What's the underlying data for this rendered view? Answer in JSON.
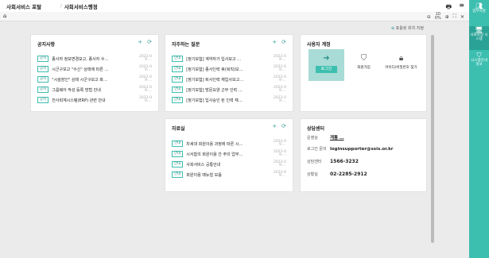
{
  "header": {
    "brand": "사회서비스 포탈",
    "sep": "/",
    "breadcrumb": "사회서비스행정"
  },
  "toolbar": {
    "home_icon": "⌂",
    "zoom": "10",
    "zoom_unit": "0%"
  },
  "hint": {
    "icon": "⊕",
    "text": "포틀릿 위치 지정"
  },
  "rail": [
    {
      "icon": "person-card-icon",
      "glyph": "⌂",
      "label": "업무지원"
    },
    {
      "icon": "monitor-icon",
      "glyph": "▤",
      "label": "사회보장 시스템"
    },
    {
      "icon": "shield-icon",
      "glyph": "◈",
      "label": "시스템안내 정보"
    }
  ],
  "notices": {
    "title": "공지사항",
    "rows": [
      {
        "badge": "공지",
        "text": "종사자 정보변경보고, 종사자 수…",
        "date": "2022-09-…"
      },
      {
        "badge": "공지",
        "text": "시군구보고 \"수신\" 상태에 따른 …",
        "date": "2022-09-…"
      },
      {
        "badge": "공지",
        "text": "\"시설장인\" 상태 시군구보고 화…",
        "date": "2022-09-…"
      },
      {
        "badge": "공지",
        "text": "그룹웨어 작성 등록 방법 안내",
        "date": "2022-09-…"
      },
      {
        "badge": "공지",
        "text": "전사회계시스템(ERP) 관련 안내",
        "date": "2022-09-…"
      }
    ]
  },
  "faq": {
    "title": "자주하는 질문",
    "rows": [
      {
        "badge": "안내",
        "text": "[정기보험] 계약자가 입사보고 …",
        "date": "2022-09-…"
      },
      {
        "badge": "안내",
        "text": "[정기보험] 종사인력 휴(복직)보…",
        "date": "2022-09-…"
      },
      {
        "badge": "안내",
        "text": "[정기보험] 퇴사인력 재입사보고…",
        "date": "2022-09-…"
      },
      {
        "badge": "안내",
        "text": "[정기보험] 방문요양 근무 인력 …",
        "date": "2022-09-…"
      },
      {
        "badge": "안내",
        "text": "[정기보험] 입사승인 된 인력 재…",
        "date": "2022-09-…"
      }
    ]
  },
  "docs": {
    "title": "자료실",
    "rows": [
      {
        "badge": "안내",
        "text": "차세대 회원이용 과정에 따른 시…",
        "date": "2022-09-…"
      },
      {
        "badge": "안내",
        "text": "시서함의 회원이용 간 주의 업무…",
        "date": "2022-09-…"
      },
      {
        "badge": "안내",
        "text": "사회서비스 공통안내",
        "date": "2022-09-…"
      },
      {
        "badge": "안내",
        "text": "회원이용 매뉴얼 모음",
        "date": "2022-09-…"
      }
    ]
  },
  "user": {
    "title": "사용자 계정",
    "tiles": [
      {
        "icon": "login-icon",
        "glyph": "➜",
        "label": "로그인"
      },
      {
        "icon": "shield-check-icon",
        "glyph": "⛉",
        "label": "회원가입"
      },
      {
        "icon": "lock-icon",
        "glyph": "🔒︎",
        "label": "아이디/비밀번호 찾기"
      }
    ]
  },
  "support": {
    "title": "상담센터",
    "rows": [
      {
        "key": "운영상",
        "value": "개통 …"
      },
      {
        "key": "로그인 문의",
        "value": "loginsupporter@ssis.or.kr"
      },
      {
        "key": "상담센터",
        "value": "1566-3232"
      },
      {
        "key": "상황실",
        "value": "02-2285-2912"
      }
    ]
  }
}
